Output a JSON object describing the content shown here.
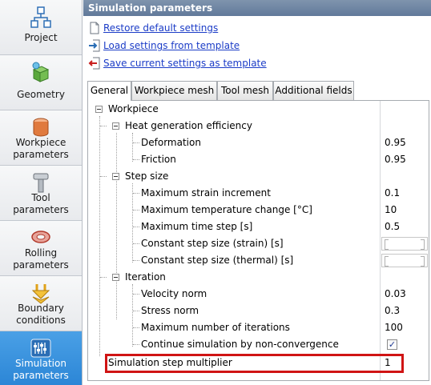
{
  "sidebar": {
    "items": [
      {
        "label": "Project",
        "icon": "project-icon"
      },
      {
        "label": "Geometry",
        "icon": "geometry-icon"
      },
      {
        "label_line1": "Workpiece",
        "label_line2": "parameters",
        "icon": "workpiece-icon"
      },
      {
        "label_line1": "Tool",
        "label_line2": "parameters",
        "icon": "tool-icon"
      },
      {
        "label_line1": "Rolling",
        "label_line2": "parameters",
        "icon": "rolling-icon"
      },
      {
        "label_line1": "Boundary",
        "label_line2": "conditions",
        "icon": "boundary-icon"
      },
      {
        "label_line1": "Simulation",
        "label_line2": "parameters",
        "icon": "simulation-icon",
        "active": true
      }
    ],
    "active_color": "#3a93df"
  },
  "panel": {
    "title": "Simulation parameters",
    "links": {
      "restore": "Restore default settings",
      "load": "Load settings from template",
      "save": "Save current settings as template"
    },
    "tabs": [
      "General",
      "Workpiece mesh",
      "Tool mesh",
      "Additional fields"
    ],
    "active_tab": "General"
  },
  "grid": {
    "workpiece": "Workpiece",
    "heat": {
      "label": "Heat generation efficiency",
      "deformation": {
        "label": "Deformation",
        "value": "0.95"
      },
      "friction": {
        "label": "Friction",
        "value": "0.95"
      }
    },
    "step": {
      "label": "Step size",
      "strain": {
        "label": "Maximum strain increment",
        "value": "0.1"
      },
      "temp": {
        "label": "Maximum temperature change [°C]",
        "value": "10"
      },
      "time": {
        "label": "Maximum time step [s]",
        "value": "0.5"
      },
      "const_strain": {
        "label": "Constant step size (strain) [s]",
        "value": ""
      },
      "const_thermal": {
        "label": "Constant step size (thermal) [s]",
        "value": ""
      }
    },
    "iteration": {
      "label": "Iteration",
      "velocity": {
        "label": "Velocity norm",
        "value": "0.03"
      },
      "stress": {
        "label": "Stress norm",
        "value": "0.3"
      },
      "max_iter": {
        "label": "Maximum number of iterations",
        "value": "100"
      },
      "continue": {
        "label": "Continue simulation by non-convergence",
        "checked": true,
        "mark": "✓"
      }
    },
    "multiplier": {
      "label": "Simulation step multiplier",
      "value": "1"
    },
    "highlight_color": "#d01414"
  }
}
